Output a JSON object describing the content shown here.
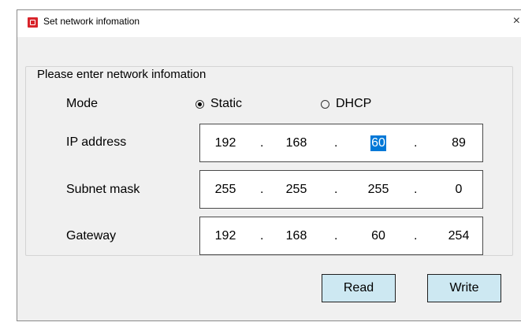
{
  "window": {
    "title": "Set network infomation",
    "close_symbol": "×"
  },
  "group": {
    "title": "Please enter  network infomation"
  },
  "mode": {
    "label": "Mode",
    "options": [
      {
        "label": "Static",
        "checked": true
      },
      {
        "label": "DHCP",
        "checked": false
      }
    ]
  },
  "fields": {
    "ip": {
      "label": "IP address",
      "octets": [
        "192",
        "168",
        "60",
        "89"
      ],
      "selected_octet": 2
    },
    "subnet": {
      "label": "Subnet mask",
      "octets": [
        "255",
        "255",
        "255",
        "0"
      ]
    },
    "gateway": {
      "label": "Gateway",
      "octets": [
        "192",
        "168",
        "60",
        "254"
      ]
    }
  },
  "separator": ".",
  "buttons": {
    "read": "Read",
    "write": "Write"
  },
  "colors": {
    "button_bg": "#cde8f2",
    "selection": "#0078d7",
    "app_icon": "#d8232a"
  }
}
